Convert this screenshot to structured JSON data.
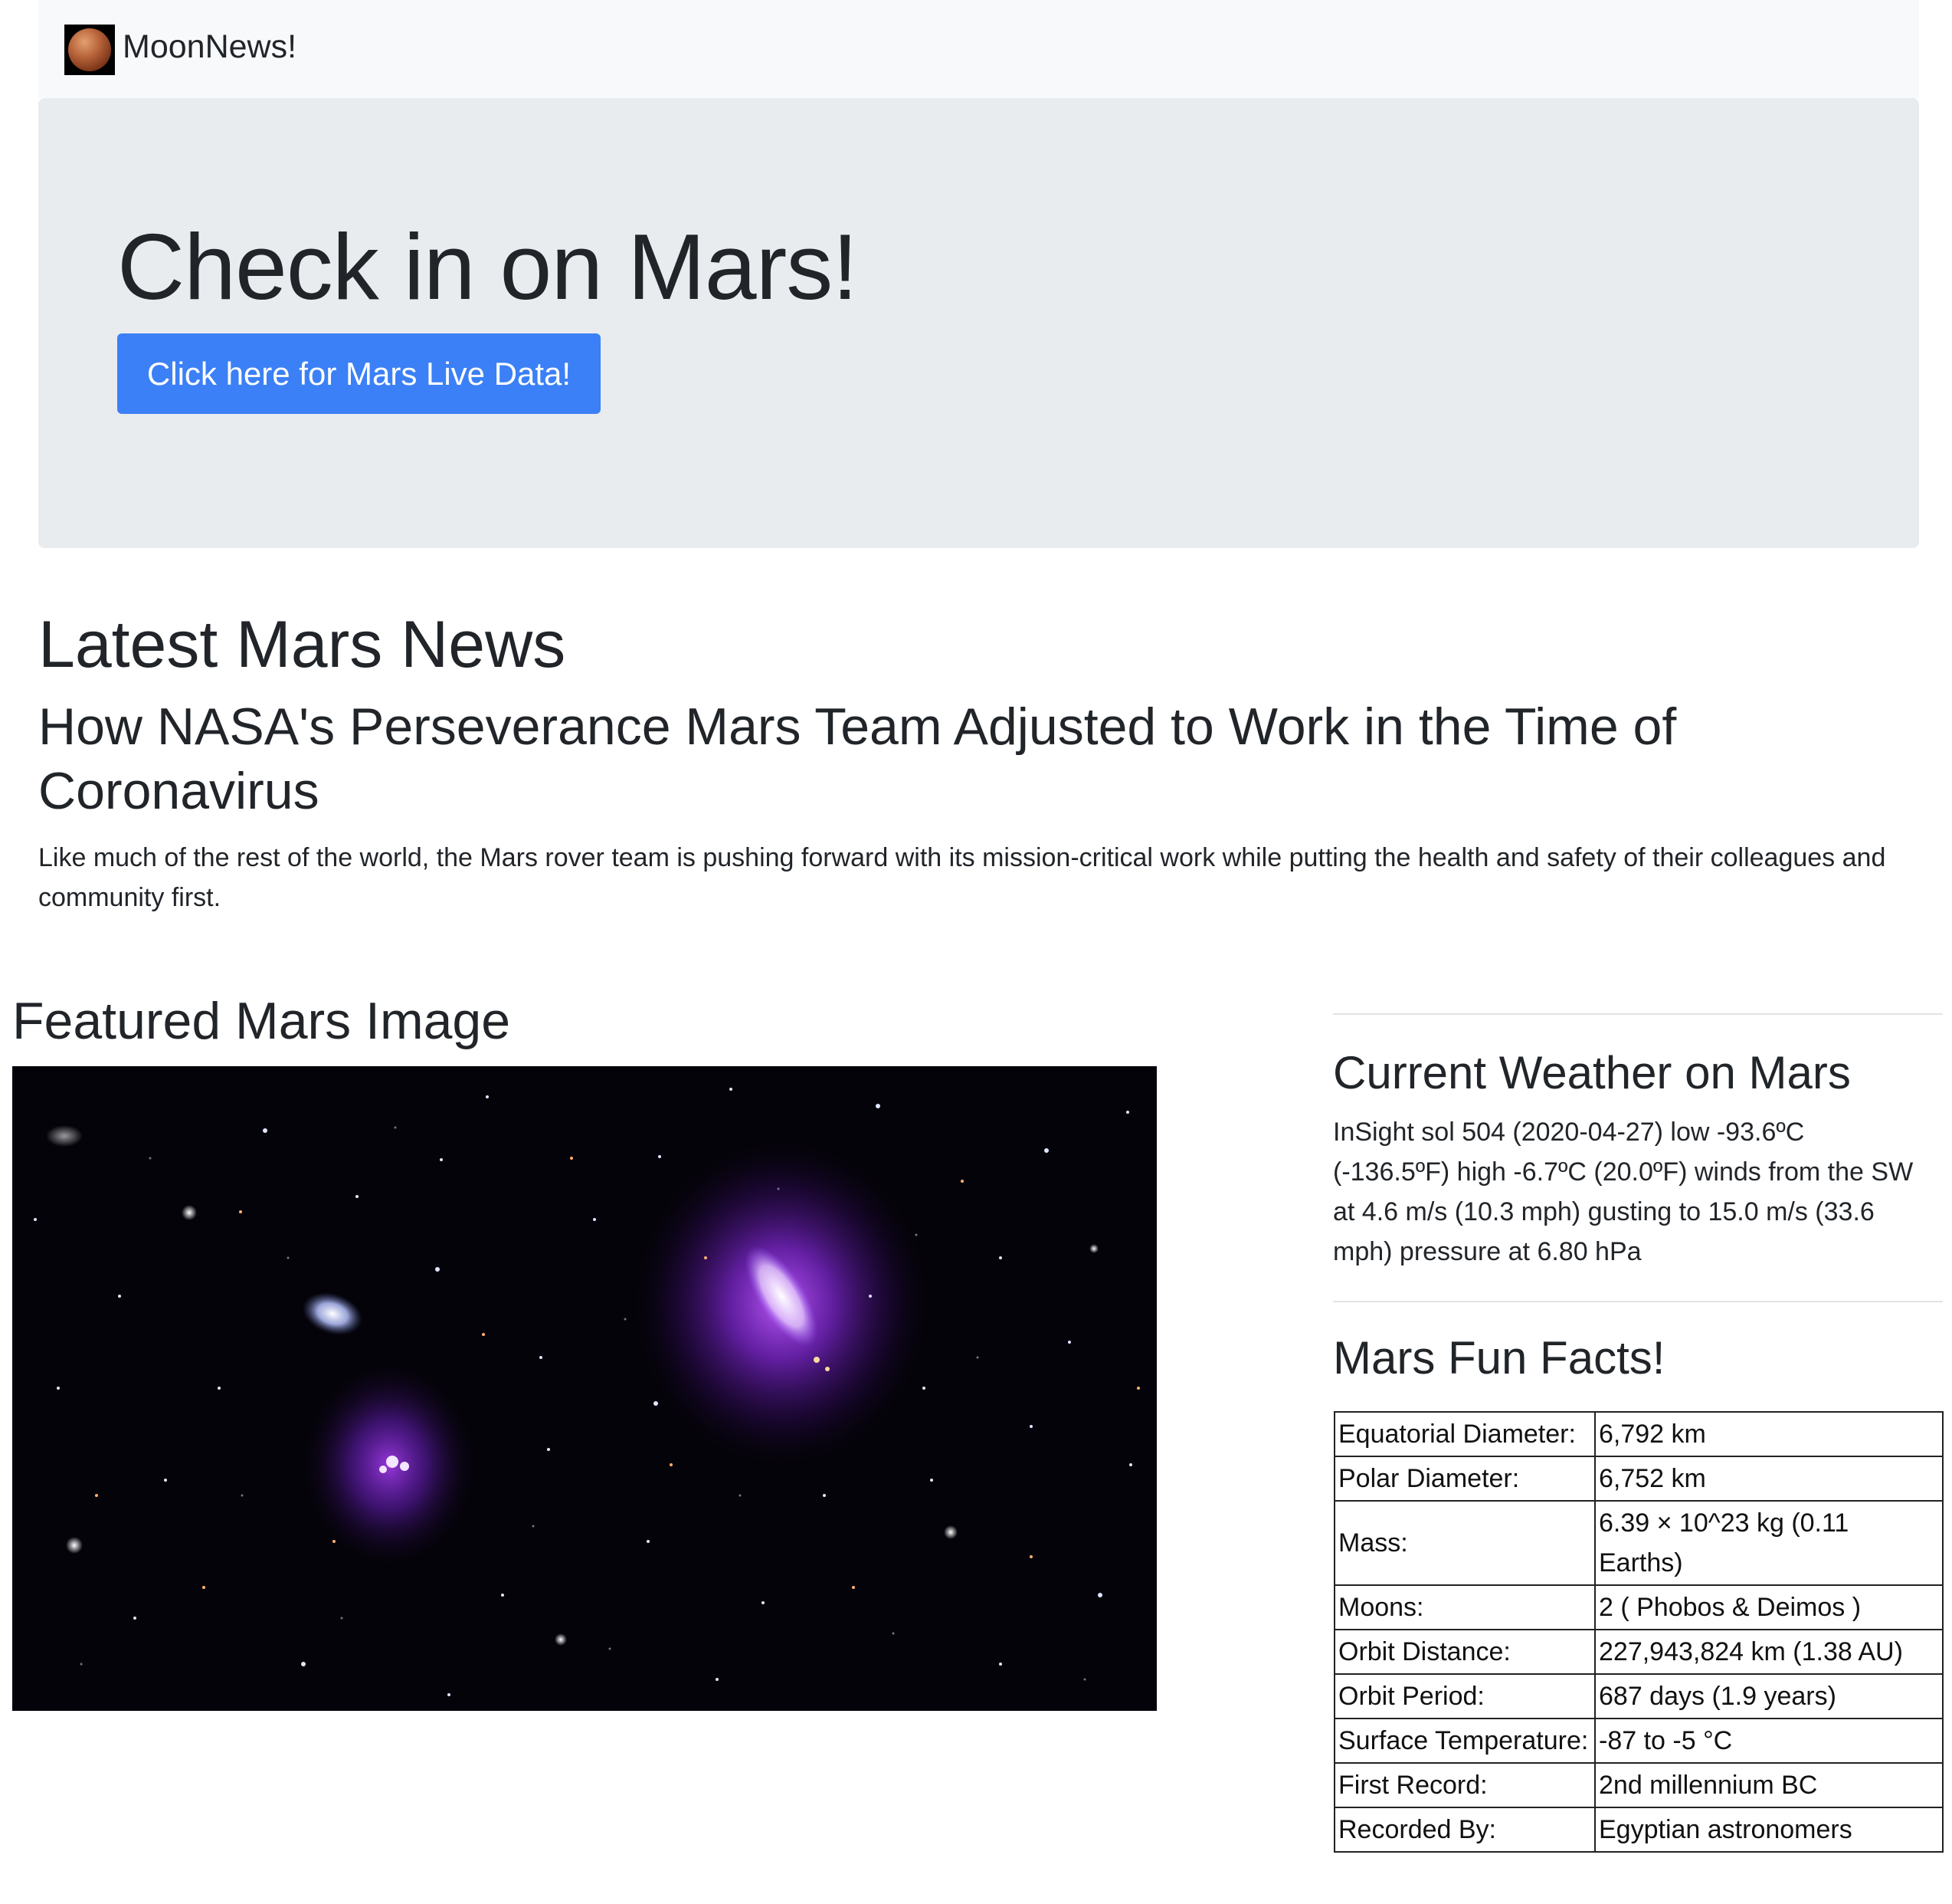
{
  "navbar": {
    "brand": "MoonNews!",
    "logo_icon": "mars-planet-icon"
  },
  "jumbotron": {
    "title": "Check in on Mars!",
    "button_label": "Click here for Mars Live Data!"
  },
  "news": {
    "heading": "Latest Mars News",
    "title": "How NASA's Perseverance Mars Team Adjusted to Work in the Time of Coronavirus",
    "teaser": "Like much of the rest of the world, the Mars rover team is pushing forward with its mission-critical work while putting the health and safety of their colleagues and community first."
  },
  "featured": {
    "heading": "Featured Mars Image"
  },
  "weather": {
    "heading": "Current Weather on Mars",
    "text": "InSight sol 504 (2020-04-27) low -93.6ºC (-136.5ºF) high -6.7ºC (20.0ºF) winds from the SW at 4.6 m/s (10.3 mph) gusting to 15.0 m/s (33.6 mph) pressure at 6.80 hPa"
  },
  "facts": {
    "heading": "Mars Fun Facts!",
    "rows": [
      {
        "label": "Equatorial Diameter:",
        "value": "6,792 km"
      },
      {
        "label": "Polar Diameter:",
        "value": "6,752 km"
      },
      {
        "label": "Mass:",
        "value": "6.39 × 10^23 kg (0.11 Earths)"
      },
      {
        "label": "Moons:",
        "value": "2 ( Phobos & Deimos )"
      },
      {
        "label": "Orbit Distance:",
        "value": "227,943,824 km (1.38 AU)"
      },
      {
        "label": "Orbit Period:",
        "value": "687 days (1.9 years)"
      },
      {
        "label": "Surface Temperature:",
        "value": "-87 to -5 °C"
      },
      {
        "label": "First Record:",
        "value": "2nd millennium BC"
      },
      {
        "label": "Recorded By:",
        "value": "Egyptian astronomers"
      }
    ]
  },
  "colors": {
    "primary_button": "#3b80f6",
    "jumbotron_bg": "#e9ecef",
    "navbar_bg": "#f8f9fa",
    "text": "#212529"
  }
}
